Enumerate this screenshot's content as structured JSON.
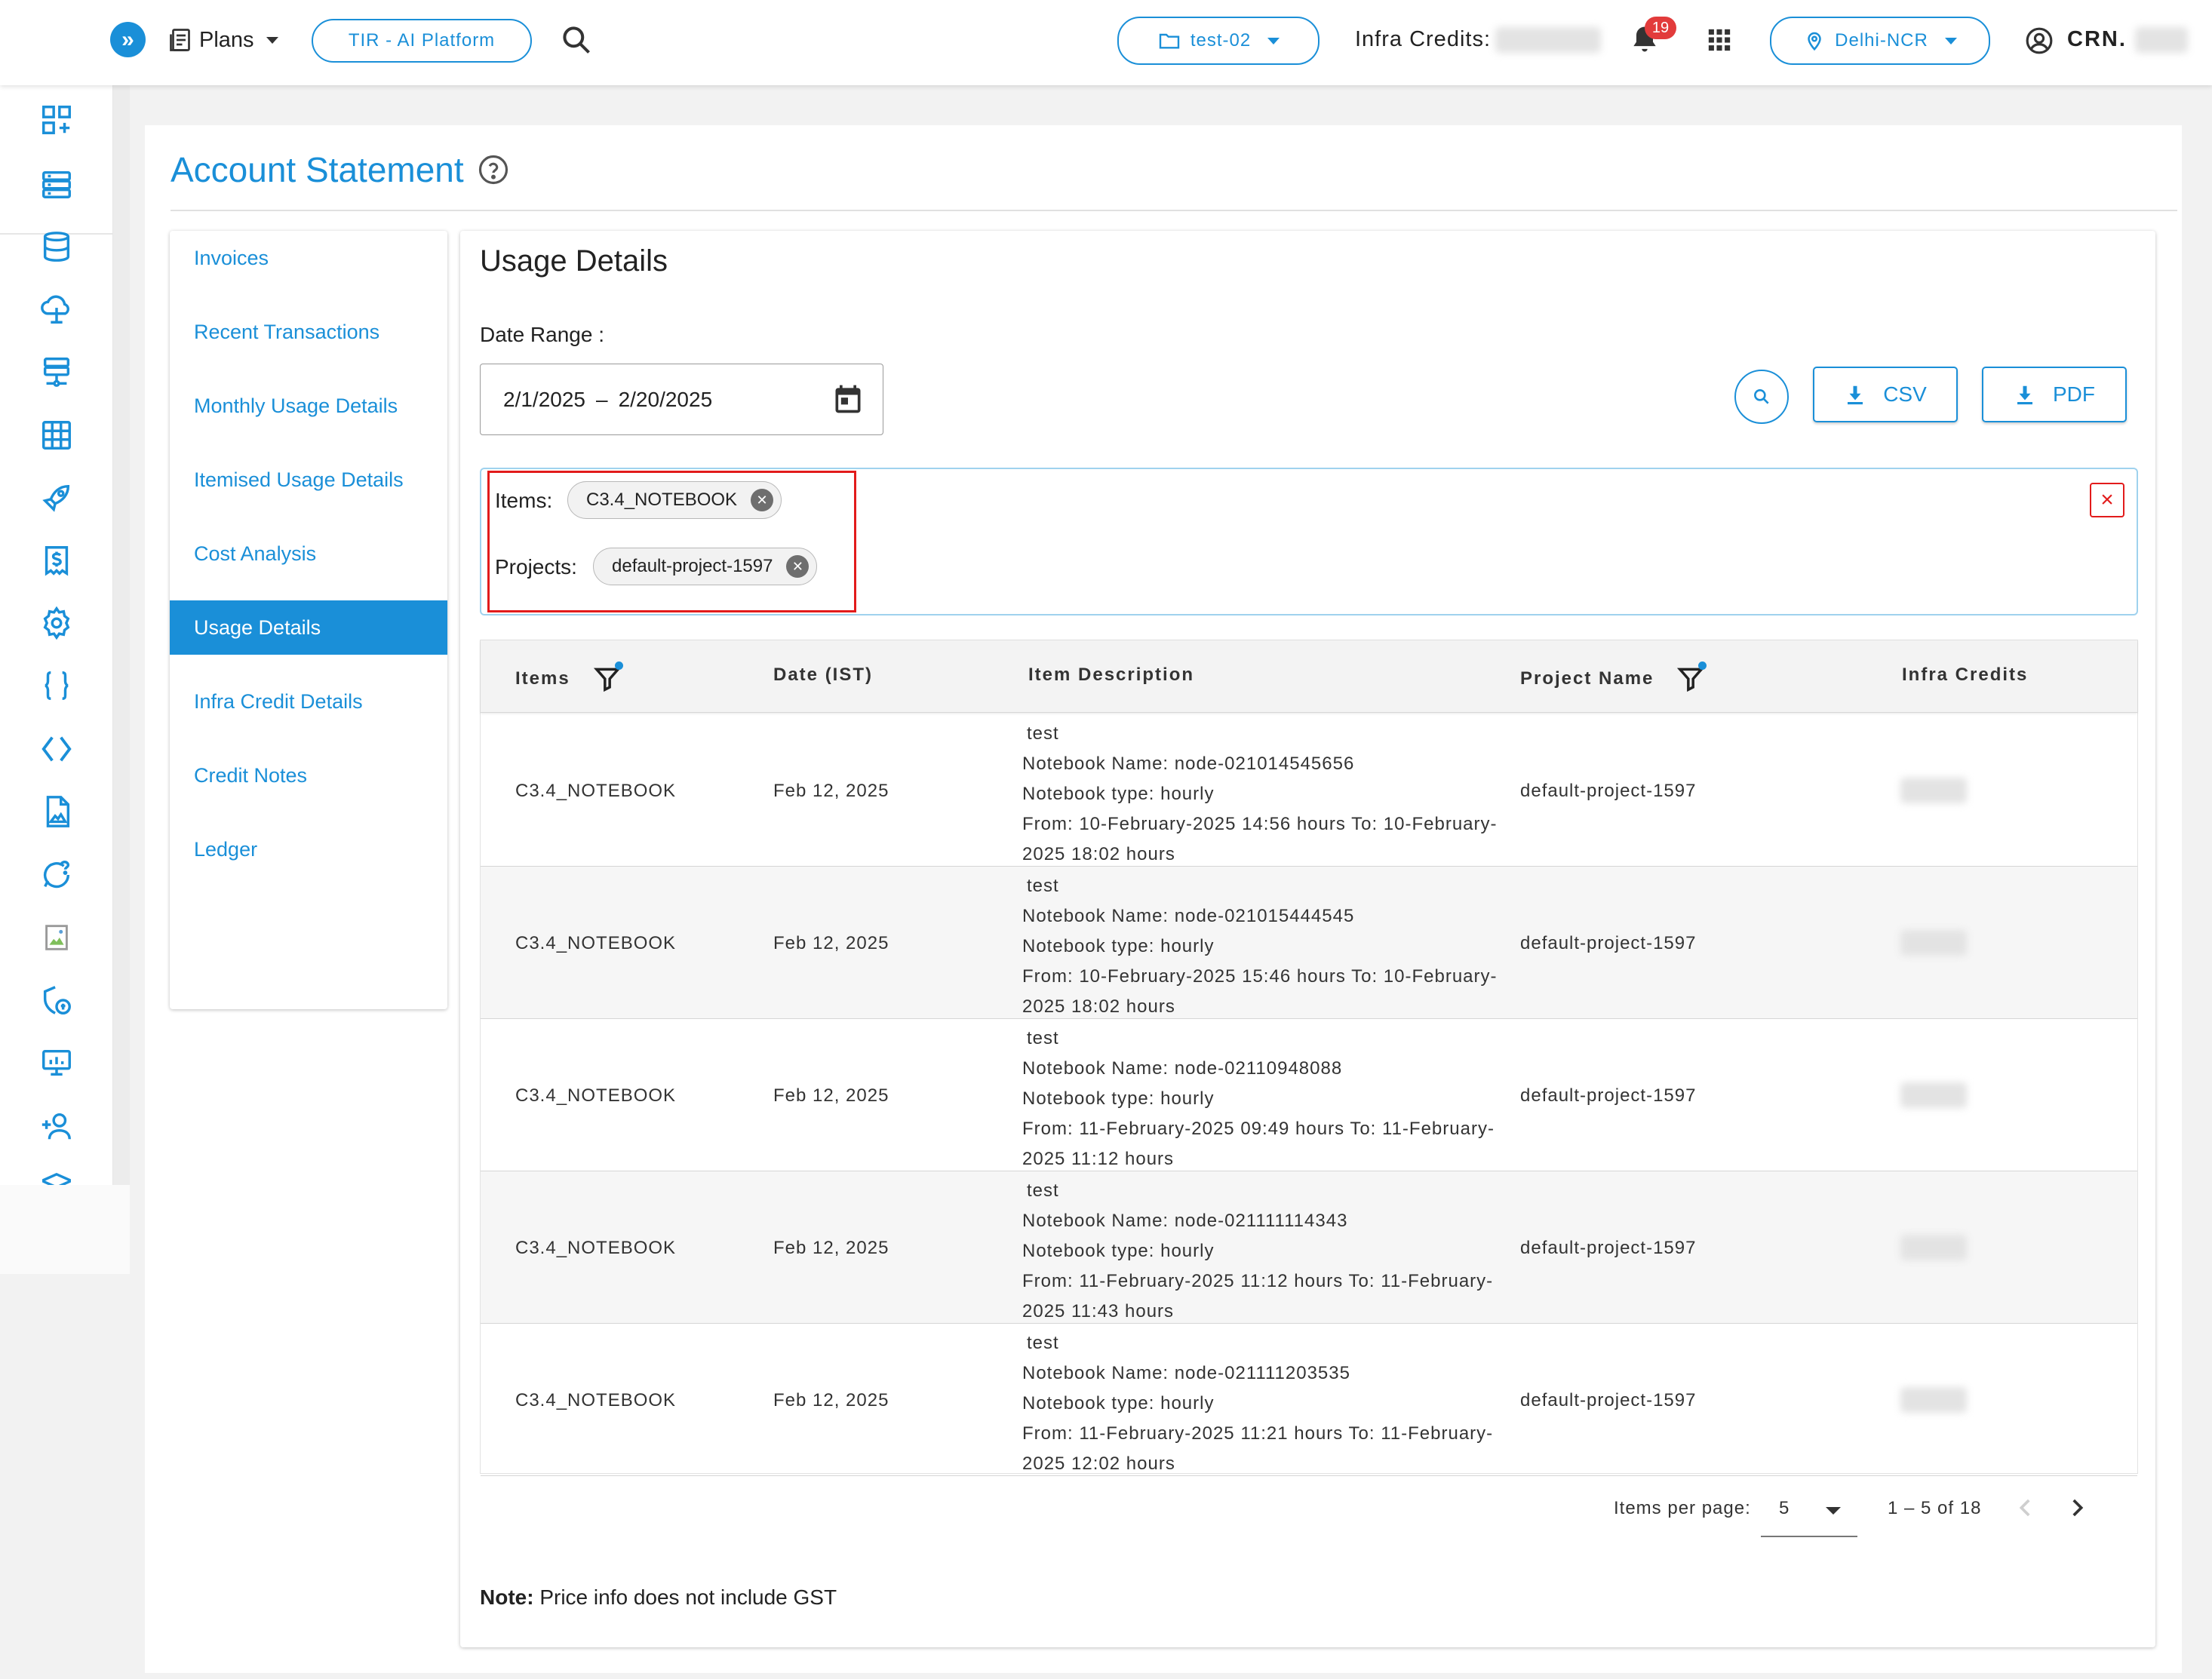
{
  "topbar": {
    "plans_label": "Plans",
    "platform_label": "TIR - AI Platform",
    "project_label": "test-02",
    "infra_credits_label": "Infra Credits:",
    "notification_count": "19",
    "region_label": "Delhi-NCR",
    "crn_label": "CRN."
  },
  "page": {
    "title": "Account Statement"
  },
  "menu": {
    "items": [
      {
        "label": "Invoices"
      },
      {
        "label": "Recent Transactions"
      },
      {
        "label": "Monthly Usage Details"
      },
      {
        "label": "Itemised Usage Details"
      },
      {
        "label": "Cost Analysis"
      },
      {
        "label": "Usage Details"
      },
      {
        "label": "Infra Credit Details"
      },
      {
        "label": "Credit Notes"
      },
      {
        "label": "Ledger"
      }
    ],
    "active": "Usage Details"
  },
  "usage": {
    "title": "Usage Details",
    "range_label": "Date Range :",
    "start_date": "2/1/2025",
    "range_separator": "–",
    "end_date": "2/20/2025",
    "csv_label": "CSV",
    "pdf_label": "PDF"
  },
  "filters": {
    "items_label": "Items:",
    "items_chip": "C3.4_NOTEBOOK",
    "projects_label": "Projects:",
    "projects_chip": "default-project-1597",
    "clear_symbol": "×"
  },
  "table": {
    "headers": {
      "items": "Items",
      "date": "Date (IST)",
      "description": "Item Description",
      "project": "Project Name",
      "credits": "Infra Credits"
    },
    "rows": [
      {
        "item": "C3.4_NOTEBOOK",
        "date": "Feb 12, 2025",
        "desc": [
          "test",
          "Notebook Name: node-021014545656",
          "Notebook type: hourly",
          "From: 10-February-2025 14:56 hours To: 10-February-",
          "2025 18:02 hours"
        ],
        "project": "default-project-1597"
      },
      {
        "item": "C3.4_NOTEBOOK",
        "date": "Feb 12, 2025",
        "desc": [
          "test",
          "Notebook Name: node-021015444545",
          "Notebook type: hourly",
          "From: 10-February-2025 15:46 hours To: 10-February-",
          "2025 18:02 hours"
        ],
        "project": "default-project-1597"
      },
      {
        "item": "C3.4_NOTEBOOK",
        "date": "Feb 12, 2025",
        "desc": [
          "test",
          "Notebook Name: node-02110948088",
          "Notebook type: hourly",
          "From: 11-February-2025 09:49 hours To: 11-February-",
          "2025 11:12 hours"
        ],
        "project": "default-project-1597"
      },
      {
        "item": "C3.4_NOTEBOOK",
        "date": "Feb 12, 2025",
        "desc": [
          "test",
          "Notebook Name: node-021111114343",
          "Notebook type: hourly",
          "From: 11-February-2025 11:12 hours To: 11-February-",
          "2025 11:43 hours"
        ],
        "project": "default-project-1597"
      },
      {
        "item": "C3.4_NOTEBOOK",
        "date": "Feb 12, 2025",
        "desc": [
          "test",
          "Notebook Name: node-021111203535",
          "Notebook type: hourly",
          "From: 11-February-2025 11:21 hours To: 11-February-",
          "2025 12:02 hours"
        ],
        "project": "default-project-1597"
      }
    ]
  },
  "pagination": {
    "items_per_page_label": "Items per page:",
    "page_size": "5",
    "range_text": "1 – 5 of 18"
  },
  "note": {
    "label": "Note:",
    "text": " Price info does not include GST"
  },
  "colors": {
    "accent": "#1a8fd8",
    "highlight": "#e21b1b",
    "badge": "#e23b3b"
  },
  "icons": {
    "sidebar": [
      "dashboard-icon",
      "server-icon",
      "database-icon",
      "cloud-upload-icon",
      "network-icon",
      "table-icon",
      "rocket-icon",
      "billing-icon",
      "settings-icon",
      "braces-icon",
      "code-icon",
      "file-image-icon",
      "chat-icon",
      "broken-image-icon",
      "security-icon",
      "monitor-icon",
      "add-user-icon",
      "shield-icon"
    ]
  }
}
